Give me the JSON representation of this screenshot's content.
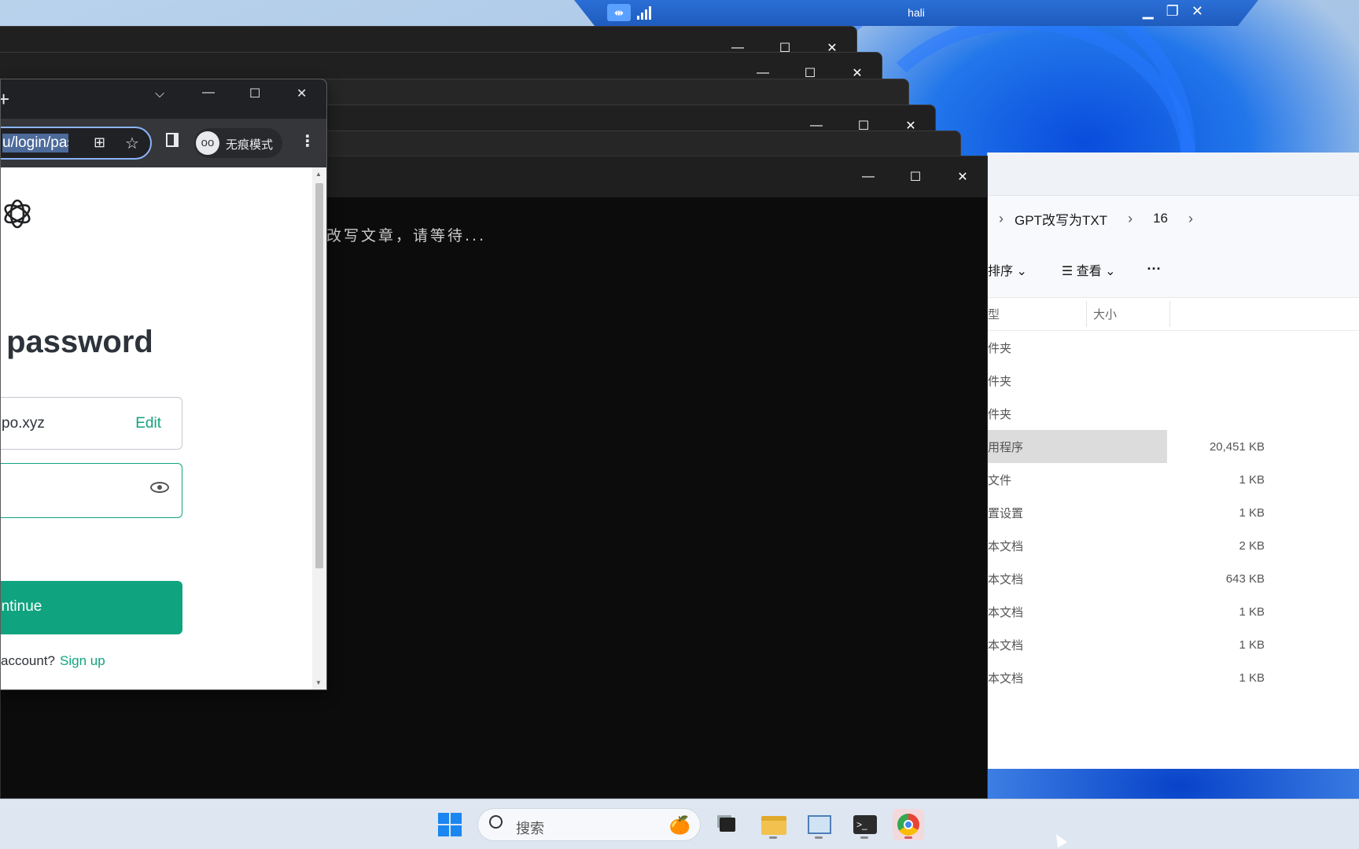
{
  "rdp_bar": {
    "title": "hali"
  },
  "window_ctrls": {
    "minimize": "—",
    "maximize": "☐",
    "close": "✕"
  },
  "terminal": {
    "output": "改写文章，请等待..."
  },
  "explorer": {
    "breadcrumb": [
      "GPT改写为TXT",
      "16"
    ],
    "toolbar": {
      "sort": "排序",
      "view": "查看",
      "more": "···"
    },
    "columns": {
      "type": "型",
      "size": "大小"
    },
    "rows": [
      {
        "type": "件夹",
        "size": ""
      },
      {
        "type": "件夹",
        "size": ""
      },
      {
        "type": "件夹",
        "size": ""
      },
      {
        "type": "用程序",
        "size": "20,451 KB"
      },
      {
        "type": "文件",
        "size": "1 KB"
      },
      {
        "type": "置设置",
        "size": "1 KB"
      },
      {
        "type": "本文档",
        "size": "2 KB"
      },
      {
        "type": "本文档",
        "size": "643 KB"
      },
      {
        "type": "本文档",
        "size": "1 KB"
      },
      {
        "type": "本文档",
        "size": "1 KB"
      },
      {
        "type": "本文档",
        "size": "1 KB"
      }
    ]
  },
  "chrome": {
    "url": "u/login/pass",
    "incognito_label": "无痕模式",
    "heading": "ur password",
    "email_value": "po.xyz",
    "edit_label": "Edit",
    "continue_label": "ontinue",
    "account_prompt": "account?",
    "signup_label": "Sign up"
  },
  "taskbar": {
    "search_label": "搜索"
  },
  "colors": {
    "accent_green": "#10a37f",
    "terminal_bg": "#0c0c0c",
    "chrome_dark": "#35363a",
    "rdp_blue": "#1f5bbd"
  }
}
